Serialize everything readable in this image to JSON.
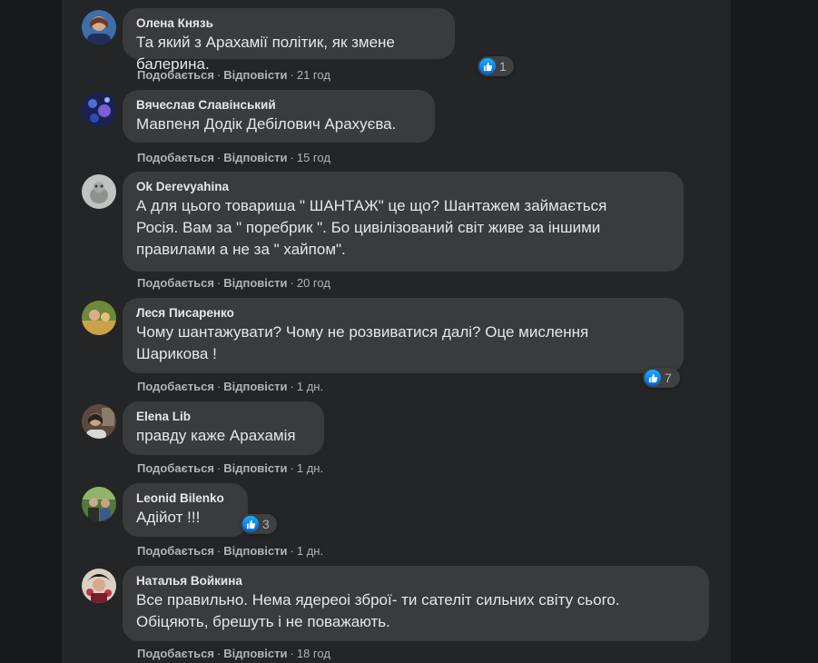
{
  "comments": [
    {
      "author": "Олена Князь",
      "text": "Та який з Арахамії політик, як змене балерина.",
      "like": "Подобається",
      "reply": "Відповісти",
      "time": "21 год",
      "reactions": "1"
    },
    {
      "author": "Вячеслав Славінський",
      "text": "Мавпеня Додік Дебілович Арахуєва.",
      "like": "Подобається",
      "reply": "Відповісти",
      "time": "15 год",
      "reactions": null
    },
    {
      "author": "Ok Derevyahina",
      "text": "А для цього товариша \" ШАНТАЖ\" це що? Шантажем займається\nРосія. Вам за \" поребрик \". Бо цивілізований світ живе за іншими\nправилами а не за \" хайпом\".",
      "like": "Подобається",
      "reply": "Відповісти",
      "time": "20 год",
      "reactions": null
    },
    {
      "author": "Леся Писаренко",
      "text": "Чому шантажувати? Чому не розвиватися далі? Оце мислення\nШарикова !",
      "like": "Подобається",
      "reply": "Відповісти",
      "time": "1 дн.",
      "reactions": "7"
    },
    {
      "author": "Elena Lib",
      "text": "правду каже Арахамія",
      "like": "Подобається",
      "reply": "Відповісти",
      "time": "1 дн.",
      "reactions": null
    },
    {
      "author": "Leonid Bilenko",
      "text": "Адійот !!!",
      "like": "Подобається",
      "reply": "Відповісти",
      "time": "1 дн.",
      "reactions": "3"
    },
    {
      "author": "Наталья Войкина",
      "text": "Все правильно. Нема ядереоі зброї- ти сателіт сильних світу сього.\nОбіцяють, брешуть і не поважають.",
      "like": "Подобається",
      "reply": "Відповісти",
      "time": "18 год",
      "reactions": null
    }
  ],
  "colors": {
    "page_bg": "#18191a",
    "feed_bg": "#242526",
    "bubble_bg": "#3a3b3c",
    "text": "#e4e6eb",
    "meta": "#b0b3b8",
    "like_blue": "#1877f2"
  },
  "icons": {
    "reaction": "like-thumb-icon"
  }
}
